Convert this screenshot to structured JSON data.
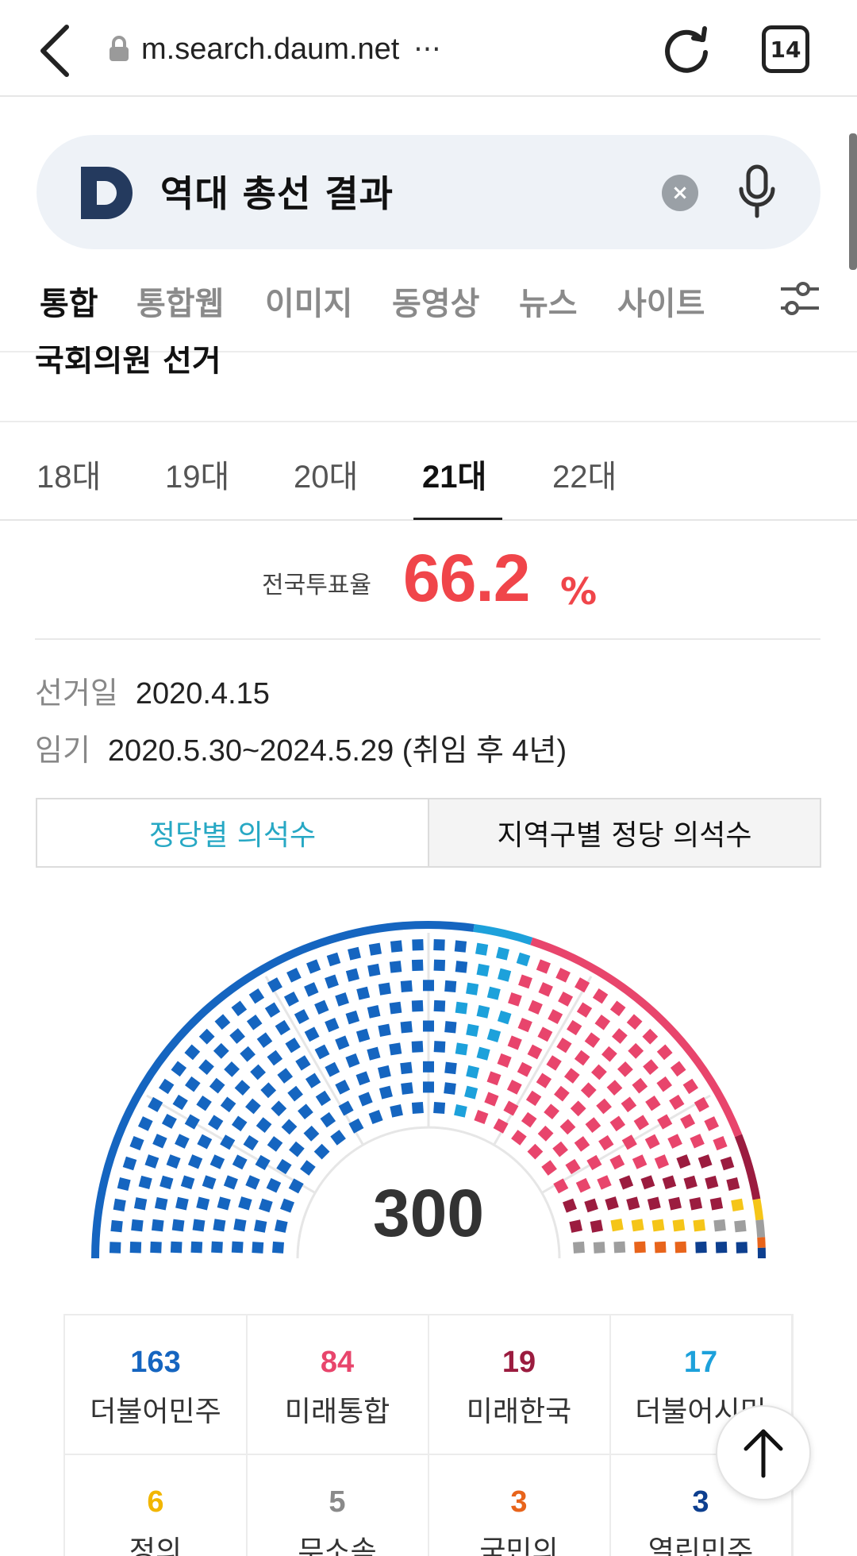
{
  "browser": {
    "url": "m.search.daum.net",
    "more": "···",
    "tab_count": "14"
  },
  "search": {
    "query": "역대 총선 결과",
    "clear_symbol": "×"
  },
  "search_tabs": [
    {
      "label": "통합",
      "active": true
    },
    {
      "label": "통합웹",
      "active": false
    },
    {
      "label": "이미지",
      "active": false
    },
    {
      "label": "동영상",
      "active": false
    },
    {
      "label": "뉴스",
      "active": false
    },
    {
      "label": "사이트",
      "active": false
    }
  ],
  "section_title": "국회의원 선거",
  "election_tabs": [
    {
      "label": "18대",
      "active": false
    },
    {
      "label": "19대",
      "active": false
    },
    {
      "label": "20대",
      "active": false
    },
    {
      "label": "21대",
      "active": true
    },
    {
      "label": "22대",
      "active": false
    }
  ],
  "turnout": {
    "label": "전국투표율",
    "value": "66.2",
    "unit": "%"
  },
  "info": {
    "election_date_label": "선거일",
    "election_date": "2020.4.15",
    "term_label": "임기",
    "term": "2020.5.30~2024.5.29 (취임 후 4년)"
  },
  "segment": {
    "party_seats": "정당별 의석수",
    "region_seats": "지역구별 정당 의석수"
  },
  "chart_data": {
    "type": "parliament-hemicycle",
    "total": "300",
    "series": [
      {
        "name": "더불어민주",
        "value": 163,
        "color": "#1565c0"
      },
      {
        "name": "더불어시민",
        "value": 17,
        "color": "#1da1db"
      },
      {
        "name": "미래통합",
        "value": 84,
        "color": "#e8456c"
      },
      {
        "name": "미래한국",
        "value": 19,
        "color": "#9b1c3f"
      },
      {
        "name": "정의",
        "value": 6,
        "color": "#f5c518"
      },
      {
        "name": "무소속",
        "value": 5,
        "color": "#9e9e9e"
      },
      {
        "name": "국민의",
        "value": 3,
        "color": "#e8641b"
      },
      {
        "name": "열린민주",
        "value": 3,
        "color": "#0d3f8f"
      }
    ]
  },
  "results": [
    {
      "num": "163",
      "name": "더불어민주",
      "color": "#1565c0"
    },
    {
      "num": "84",
      "name": "미래통합",
      "color": "#e8456c"
    },
    {
      "num": "19",
      "name": "미래한국",
      "color": "#9b1c3f"
    },
    {
      "num": "17",
      "name": "더불어시민",
      "color": "#1da1db"
    },
    {
      "num": "6",
      "name": "정의",
      "color": "#f2b600"
    },
    {
      "num": "5",
      "name": "무소속",
      "color": "#8a8a8a"
    },
    {
      "num": "3",
      "name": "국민의",
      "color": "#e8641b"
    },
    {
      "num": "3",
      "name": "열린민주",
      "color": "#0d3f8f"
    }
  ]
}
